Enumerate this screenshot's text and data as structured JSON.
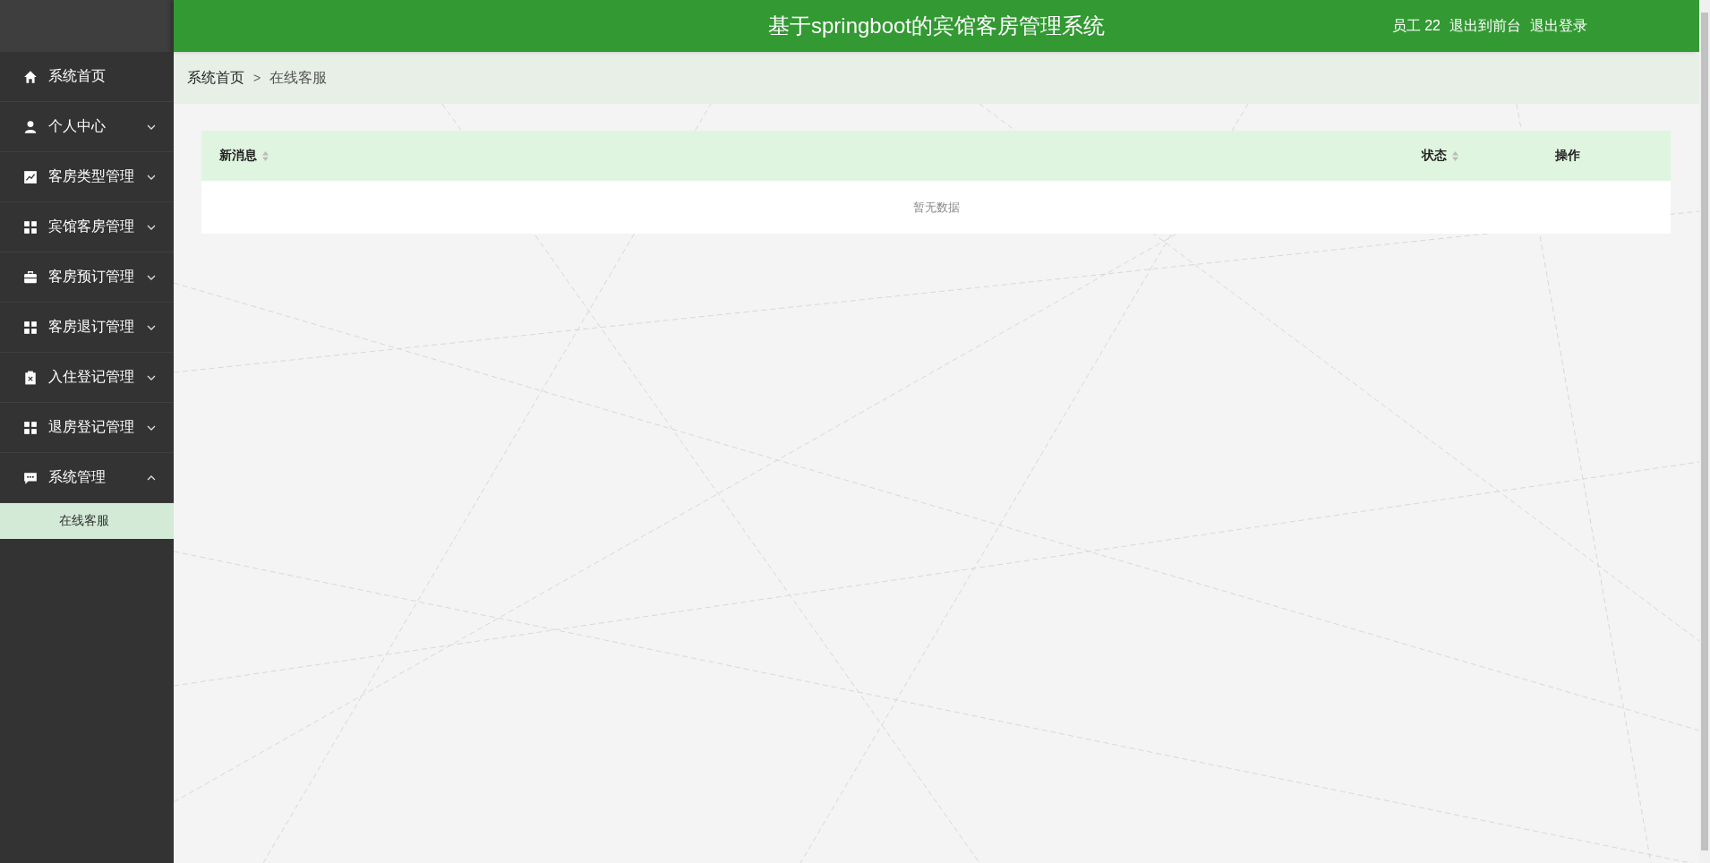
{
  "header": {
    "title": "基于springboot的宾馆客房管理系统",
    "user": "员工 22",
    "links": [
      "退出到前台",
      "退出登录"
    ]
  },
  "sidebar": {
    "items": [
      {
        "label": "系统首页",
        "kind": "link"
      },
      {
        "label": "个人中心",
        "kind": "group",
        "expanded": false
      },
      {
        "label": "客房类型管理",
        "kind": "group",
        "expanded": false
      },
      {
        "label": "宾馆客房管理",
        "kind": "group",
        "expanded": false
      },
      {
        "label": "客房预订管理",
        "kind": "group",
        "expanded": false
      },
      {
        "label": "客房退订管理",
        "kind": "group",
        "expanded": false
      },
      {
        "label": "入住登记管理",
        "kind": "group",
        "expanded": false
      },
      {
        "label": "退房登记管理",
        "kind": "group",
        "expanded": false
      },
      {
        "label": "系统管理",
        "kind": "group",
        "expanded": true,
        "children": [
          {
            "label": "在线客服",
            "selected": true
          }
        ]
      }
    ]
  },
  "breadcrumb": [
    "系统首页",
    "在线客服"
  ],
  "breadcrumb_separator": ">",
  "table": {
    "columns": [
      {
        "label": "新消息",
        "sortable": true
      },
      {
        "label": "状态",
        "sortable": true
      },
      {
        "label": "操作",
        "sortable": false
      }
    ],
    "empty_text": "暂无数据"
  }
}
